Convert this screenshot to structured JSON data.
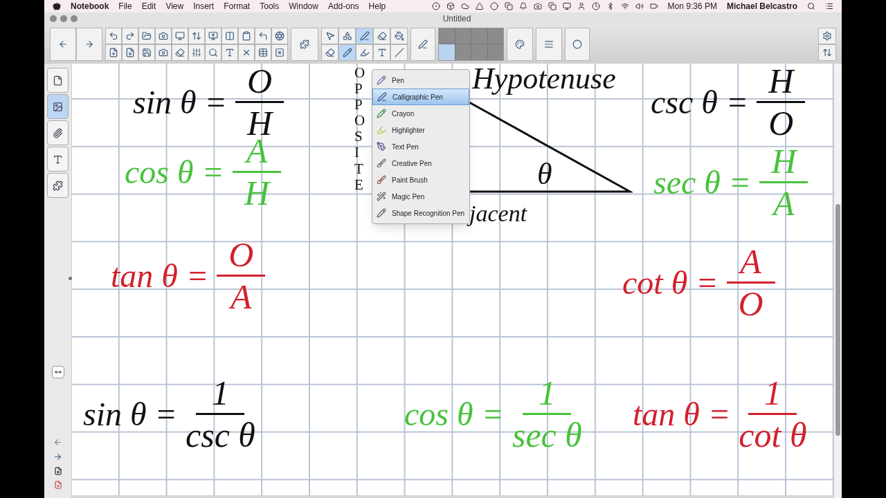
{
  "menu_bar": {
    "app": "Notebook",
    "menus": [
      "File",
      "Edit",
      "View",
      "Insert",
      "Format",
      "Tools",
      "Window",
      "Add-ons",
      "Help"
    ],
    "clock": "Mon 9:36 PM",
    "user": "Michael Belcastro"
  },
  "window": {
    "title": "Untitled"
  },
  "sidebar_tabs": [
    {
      "selected": false
    },
    {
      "selected": true
    },
    {
      "selected": false
    },
    {
      "selected": false
    },
    {
      "selected": false
    }
  ],
  "pen_menu": [
    {
      "label": "Pen",
      "selected": false
    },
    {
      "label": "Calligraphic Pen",
      "selected": true
    },
    {
      "label": "Crayon",
      "selected": false
    },
    {
      "label": "Highlighter",
      "selected": false
    },
    {
      "label": "Text Pen",
      "selected": false
    },
    {
      "label": "Creative Pen",
      "selected": false
    },
    {
      "label": "Paint Brush",
      "selected": false
    },
    {
      "label": "Magic Pen",
      "selected": false
    },
    {
      "label": "Shape Recognition Pen",
      "selected": false
    }
  ],
  "canvas": {
    "items": [
      {
        "kind": "equation",
        "lhs": "sin θ =",
        "numerator": "O",
        "denominator": "H",
        "color": "#111111"
      },
      {
        "kind": "vertical_label",
        "text": "OPPOSITE",
        "color": "#111111"
      },
      {
        "kind": "label",
        "text": "Hypotenuse",
        "color": "#111111"
      },
      {
        "kind": "equation",
        "lhs": "csc θ =",
        "numerator": "H",
        "denominator": "O",
        "color": "#111111"
      },
      {
        "kind": "equation",
        "lhs": "cos θ =",
        "numerator": "A",
        "denominator": "H",
        "color": "#48c23c"
      },
      {
        "kind": "label",
        "text": "θ",
        "color": "#111111"
      },
      {
        "kind": "equation",
        "lhs": "sec θ =",
        "numerator": "H",
        "denominator": "A",
        "color": "#48c23c"
      },
      {
        "kind": "label",
        "text": "jacent",
        "color": "#111111"
      },
      {
        "kind": "equation",
        "lhs": "tan θ =",
        "numerator": "O",
        "denominator": "A",
        "color": "#d41f2c"
      },
      {
        "kind": "equation",
        "lhs": "cot θ =",
        "numerator": "A",
        "denominator": "O",
        "color": "#d41f2c"
      },
      {
        "kind": "equation",
        "lhs": "sin θ =",
        "numerator": "1",
        "denominator": "csc θ",
        "color": "#111111"
      },
      {
        "kind": "equation",
        "lhs": "cos θ =",
        "numerator": "1",
        "denominator": "sec θ",
        "color": "#48c23c"
      },
      {
        "kind": "equation",
        "lhs": "tan θ =",
        "numerator": "1",
        "denominator": "cot θ",
        "color": "#d41f2c"
      }
    ]
  }
}
